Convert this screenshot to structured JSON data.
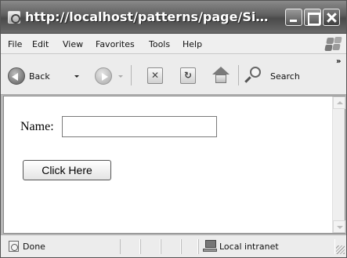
{
  "window": {
    "title": "http://localhost/patterns/page/Simpl..."
  },
  "menu": {
    "items": [
      "File",
      "Edit",
      "View",
      "Favorites",
      "Tools",
      "Help"
    ]
  },
  "toolbar": {
    "back_label": "Back",
    "search_label": "Search",
    "stop_glyph": "✕",
    "refresh_glyph": "↻",
    "overflow_glyph": "»"
  },
  "page": {
    "name_label": "Name:",
    "name_value": "",
    "button_label": "Click Here"
  },
  "status": {
    "left_text": "Done",
    "zone_text": "Local intranet"
  },
  "icons": [
    "ie-page-icon",
    "minimize-icon",
    "maximize-icon",
    "close-icon",
    "windows-logo-icon",
    "back-arrow-icon",
    "forward-arrow-icon",
    "stop-icon",
    "refresh-icon",
    "home-icon",
    "search-icon",
    "page-done-icon",
    "intranet-icon"
  ]
}
